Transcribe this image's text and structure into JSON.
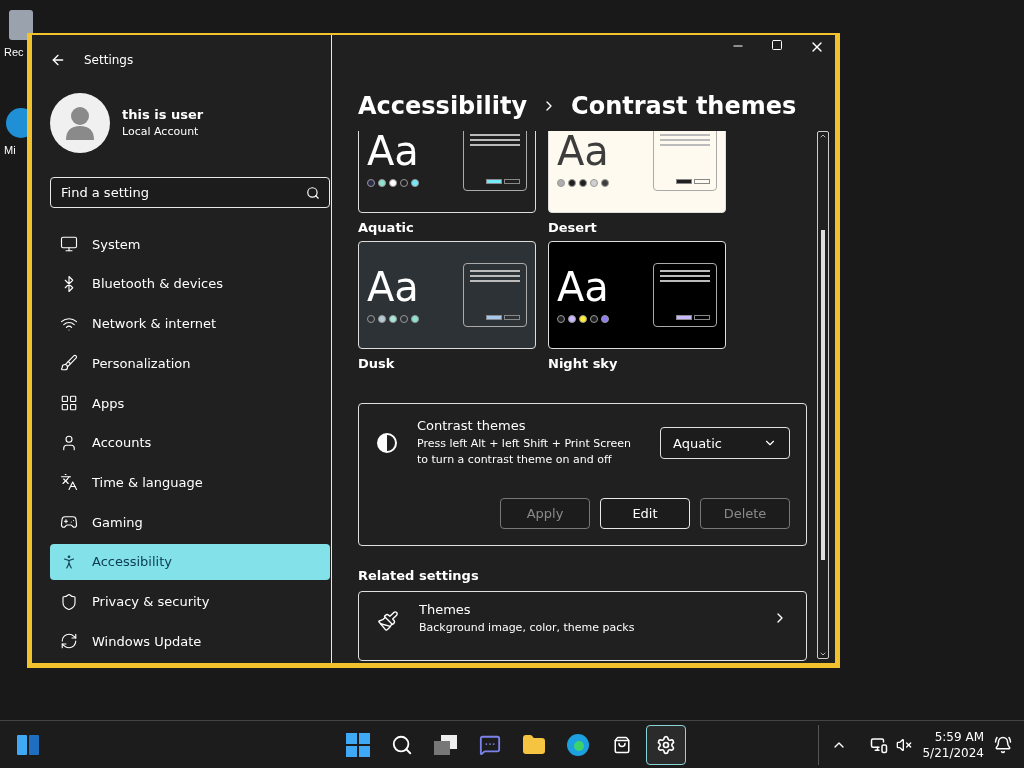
{
  "desktop_icons": [
    {
      "label": "Rec",
      "kind": "bin"
    },
    {
      "label": "Mi",
      "kind": "edge"
    }
  ],
  "window": {
    "title": "Settings"
  },
  "account": {
    "name": "this is user",
    "type": "Local Account"
  },
  "search": {
    "placeholder": "Find a setting"
  },
  "sidebar": {
    "items": [
      {
        "label": "System",
        "selected": false
      },
      {
        "label": "Bluetooth & devices",
        "selected": false
      },
      {
        "label": "Network & internet",
        "selected": false
      },
      {
        "label": "Personalization",
        "selected": false
      },
      {
        "label": "Apps",
        "selected": false
      },
      {
        "label": "Accounts",
        "selected": false
      },
      {
        "label": "Time & language",
        "selected": false
      },
      {
        "label": "Gaming",
        "selected": false
      },
      {
        "label": "Accessibility",
        "selected": true
      },
      {
        "label": "Privacy & security",
        "selected": false
      },
      {
        "label": "Windows Update",
        "selected": false
      }
    ]
  },
  "breadcrumb": [
    "Accessibility",
    "Contrast themes"
  ],
  "themes": [
    {
      "name": "Aquatic",
      "sample": "Aa"
    },
    {
      "name": "Desert",
      "sample": "Aa"
    },
    {
      "name": "Dusk",
      "sample": "Aa"
    },
    {
      "name": "Night sky",
      "sample": "Aa"
    }
  ],
  "contrast_setting": {
    "title": "Contrast themes",
    "description": "Press left Alt + left Shift + Print Screen to turn a contrast theme on and off",
    "dropdown": {
      "value": "Aquatic"
    },
    "buttons": [
      {
        "label": "Apply",
        "disabled": true
      },
      {
        "label": "Edit",
        "disabled": false
      },
      {
        "label": "Delete",
        "disabled": true
      }
    ]
  },
  "related_settings": {
    "heading": "Related settings",
    "items": [
      {
        "title": "Themes",
        "description": "Background image, color, theme packs"
      }
    ]
  },
  "taskbar": {
    "apps": [
      {
        "kind": "start",
        "active": false
      },
      {
        "kind": "search",
        "active": false
      },
      {
        "kind": "taskview",
        "active": false
      },
      {
        "kind": "chat",
        "active": false
      },
      {
        "kind": "explorer",
        "active": false
      },
      {
        "kind": "edge",
        "active": false
      },
      {
        "kind": "store",
        "active": false
      },
      {
        "kind": "settings",
        "active": true
      }
    ],
    "time": "5:59 AM",
    "date": "5/21/2024"
  }
}
